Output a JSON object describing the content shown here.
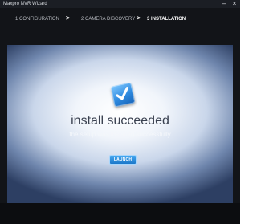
{
  "window": {
    "title": "Maxpro NVR Wizard",
    "minimize_glyph": "–",
    "close_glyph": "×"
  },
  "steps": [
    {
      "label": "1  CONFIGURATION",
      "state": "done"
    },
    {
      "label": "2 CAMERA DISCOVERY",
      "state": "done"
    },
    {
      "label": "3 INSTALLATION",
      "state": "active"
    }
  ],
  "separator": ">",
  "result": {
    "icon": "checkmark-icon",
    "heading": "install succeeded",
    "message": "the setup was installed successfully"
  },
  "actions": {
    "launch_label": "LAUNCH"
  },
  "colors": {
    "accent": "#2f8be0",
    "window_bg": "#121418"
  }
}
